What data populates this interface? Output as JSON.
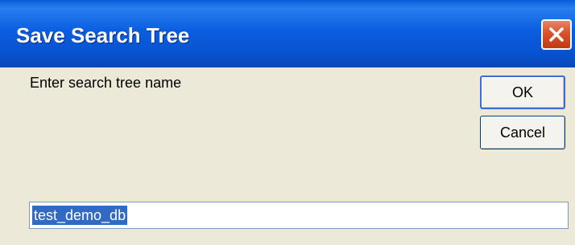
{
  "window": {
    "title": "Save Search Tree",
    "close_icon": "close-icon"
  },
  "dialog": {
    "prompt": "Enter search tree name",
    "name_value": "test_demo_db",
    "ok_label": "OK",
    "cancel_label": "Cancel"
  },
  "colors": {
    "titlebar": "#0b5ee0",
    "close_button": "#d9522a",
    "dialog_background": "#ece9d8",
    "selection": "#316ac5"
  }
}
